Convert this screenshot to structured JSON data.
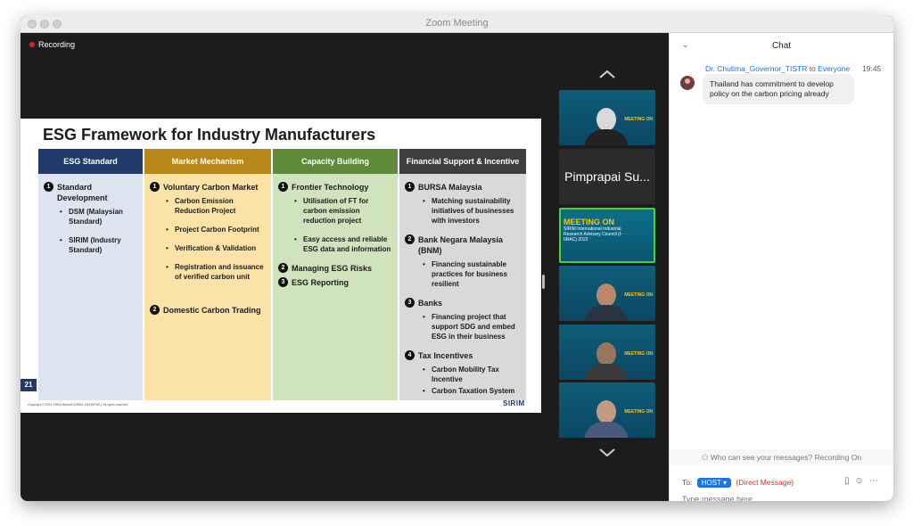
{
  "window": {
    "title": "Zoom Meeting"
  },
  "recording": "Recording",
  "slide": {
    "title": "ESG Framework for Industry Manufacturers",
    "number": "21",
    "copyright": "Copyright © 2023 SIRIM Berhad (SIRIM: INITIATIVE). All rights reserved",
    "logo": "SIRIM",
    "columns": [
      {
        "header": "ESG Standard",
        "header_color": "#1f3a6b",
        "body_color": "#dde4f0",
        "items": [
          {
            "num": "1",
            "title": "Standard Development",
            "subs": [
              "DSM (Malaysian Standard)",
              "SIRIM (Industry Standard)"
            ]
          }
        ]
      },
      {
        "header": "Market Mechanism",
        "header_color": "#b8871b",
        "body_color": "#fbe3a8",
        "items": [
          {
            "num": "1",
            "title": "Voluntary Carbon Market",
            "subs": [
              "Carbon Emission Reduction Project",
              "Project Carbon Footprint",
              "Verification & Validation",
              "Registration and issuance of verified carbon unit"
            ]
          },
          {
            "num": "2",
            "title": "Domestic Carbon Trading",
            "subs": []
          }
        ]
      },
      {
        "header": "Capacity Building",
        "header_color": "#5f8a3a",
        "body_color": "#cfe3bd",
        "items": [
          {
            "num": "1",
            "title": "Frontier Technology",
            "subs": [
              "Utilisation of FT for carbon emission reduction project",
              "Easy access and reliable ESG data and information"
            ]
          },
          {
            "num": "2",
            "title": "Managing ESG Risks",
            "subs": []
          },
          {
            "num": "3",
            "title": "ESG Reporting",
            "subs": []
          }
        ]
      },
      {
        "header": "Financial Support & Incentive",
        "header_color": "#3e3e3e",
        "body_color": "#d9d9d9",
        "items": [
          {
            "num": "1",
            "title": "BURSA Malaysia",
            "subs": [
              "Matching sustainability initiatives of businesses with investors"
            ]
          },
          {
            "num": "2",
            "title": "Bank Negara Malaysia (BNM)",
            "subs": [
              "Financing sustainable practices for business resilient"
            ]
          },
          {
            "num": "3",
            "title": "Banks",
            "subs": [
              "Financing project that support SDG and embed ESG in their business"
            ]
          },
          {
            "num": "4",
            "title": "Tax Incentives",
            "subs": [
              "Carbon Mobility Tax Incentive",
              "Carbon Taxation System"
            ]
          }
        ]
      }
    ]
  },
  "gallery": {
    "name_tile": "Pimprapai Su...",
    "meeting_tile": {
      "heading": "MEETING ON",
      "text": "SIRIM International Industrial Research Advisory Council (I-IIRAC) 2022"
    },
    "overlay": {
      "heading": "MEETING ON",
      "text": "SIRIM International Industrial Research Advisory Council (I-IIRAC)"
    }
  },
  "chat": {
    "title": "Chat",
    "message": {
      "from": "Dr. Chutima_Governor_TISTR",
      "to_word": "to",
      "to": "Everyone",
      "time": "19:45",
      "text": "Thailand has commitment to develop policy on the carbon pricing already"
    },
    "notice": "Who can see your messages? Recording On",
    "to_label": "To:",
    "recipient": "HOST",
    "direct": "(Direct Message)",
    "placeholder": "Type message here..."
  }
}
